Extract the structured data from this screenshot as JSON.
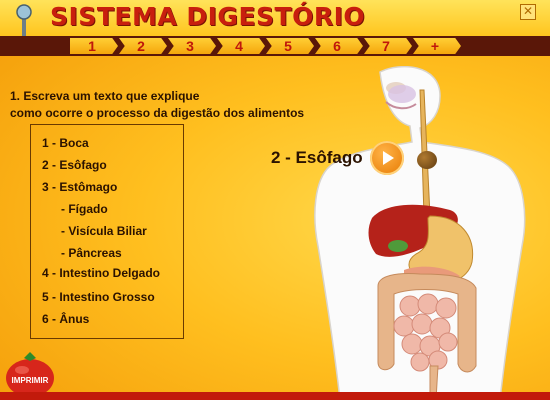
{
  "app": {
    "title": "SISTEMA DIGESTÓRIO"
  },
  "window": {
    "close_label": "✕"
  },
  "nav": {
    "items": [
      "1",
      "2",
      "3",
      "4",
      "5",
      "6",
      "7",
      "+"
    ]
  },
  "question": {
    "line1": "1. Escreva um texto que explique",
    "line2": "como ocorre o processo da digestão dos alimentos"
  },
  "organs": [
    {
      "label": "1 - Boca"
    },
    {
      "label": "2 - Esôfago"
    },
    {
      "label": "3 - Estômago"
    },
    {
      "label": "- Fígado"
    },
    {
      "label": "- Visícula Biliar"
    },
    {
      "label": "- Pâncreas"
    },
    {
      "label": "4 - Intestino Delgado"
    },
    {
      "label": "5 - Intestino Grosso"
    },
    {
      "label": "6 - Ânus"
    }
  ],
  "selected": {
    "label": "2 - Esôfago"
  },
  "print_button": {
    "label": "IMPRIMIR"
  },
  "colors": {
    "title": "#c81f0e",
    "nav_bar": "#5a1708",
    "background": "#ffbf1f",
    "text": "#2b1200"
  },
  "icons": {
    "play": "play-icon",
    "close": "close-icon",
    "print": "tomato-print-icon",
    "logo": "lamp-logo-icon"
  }
}
